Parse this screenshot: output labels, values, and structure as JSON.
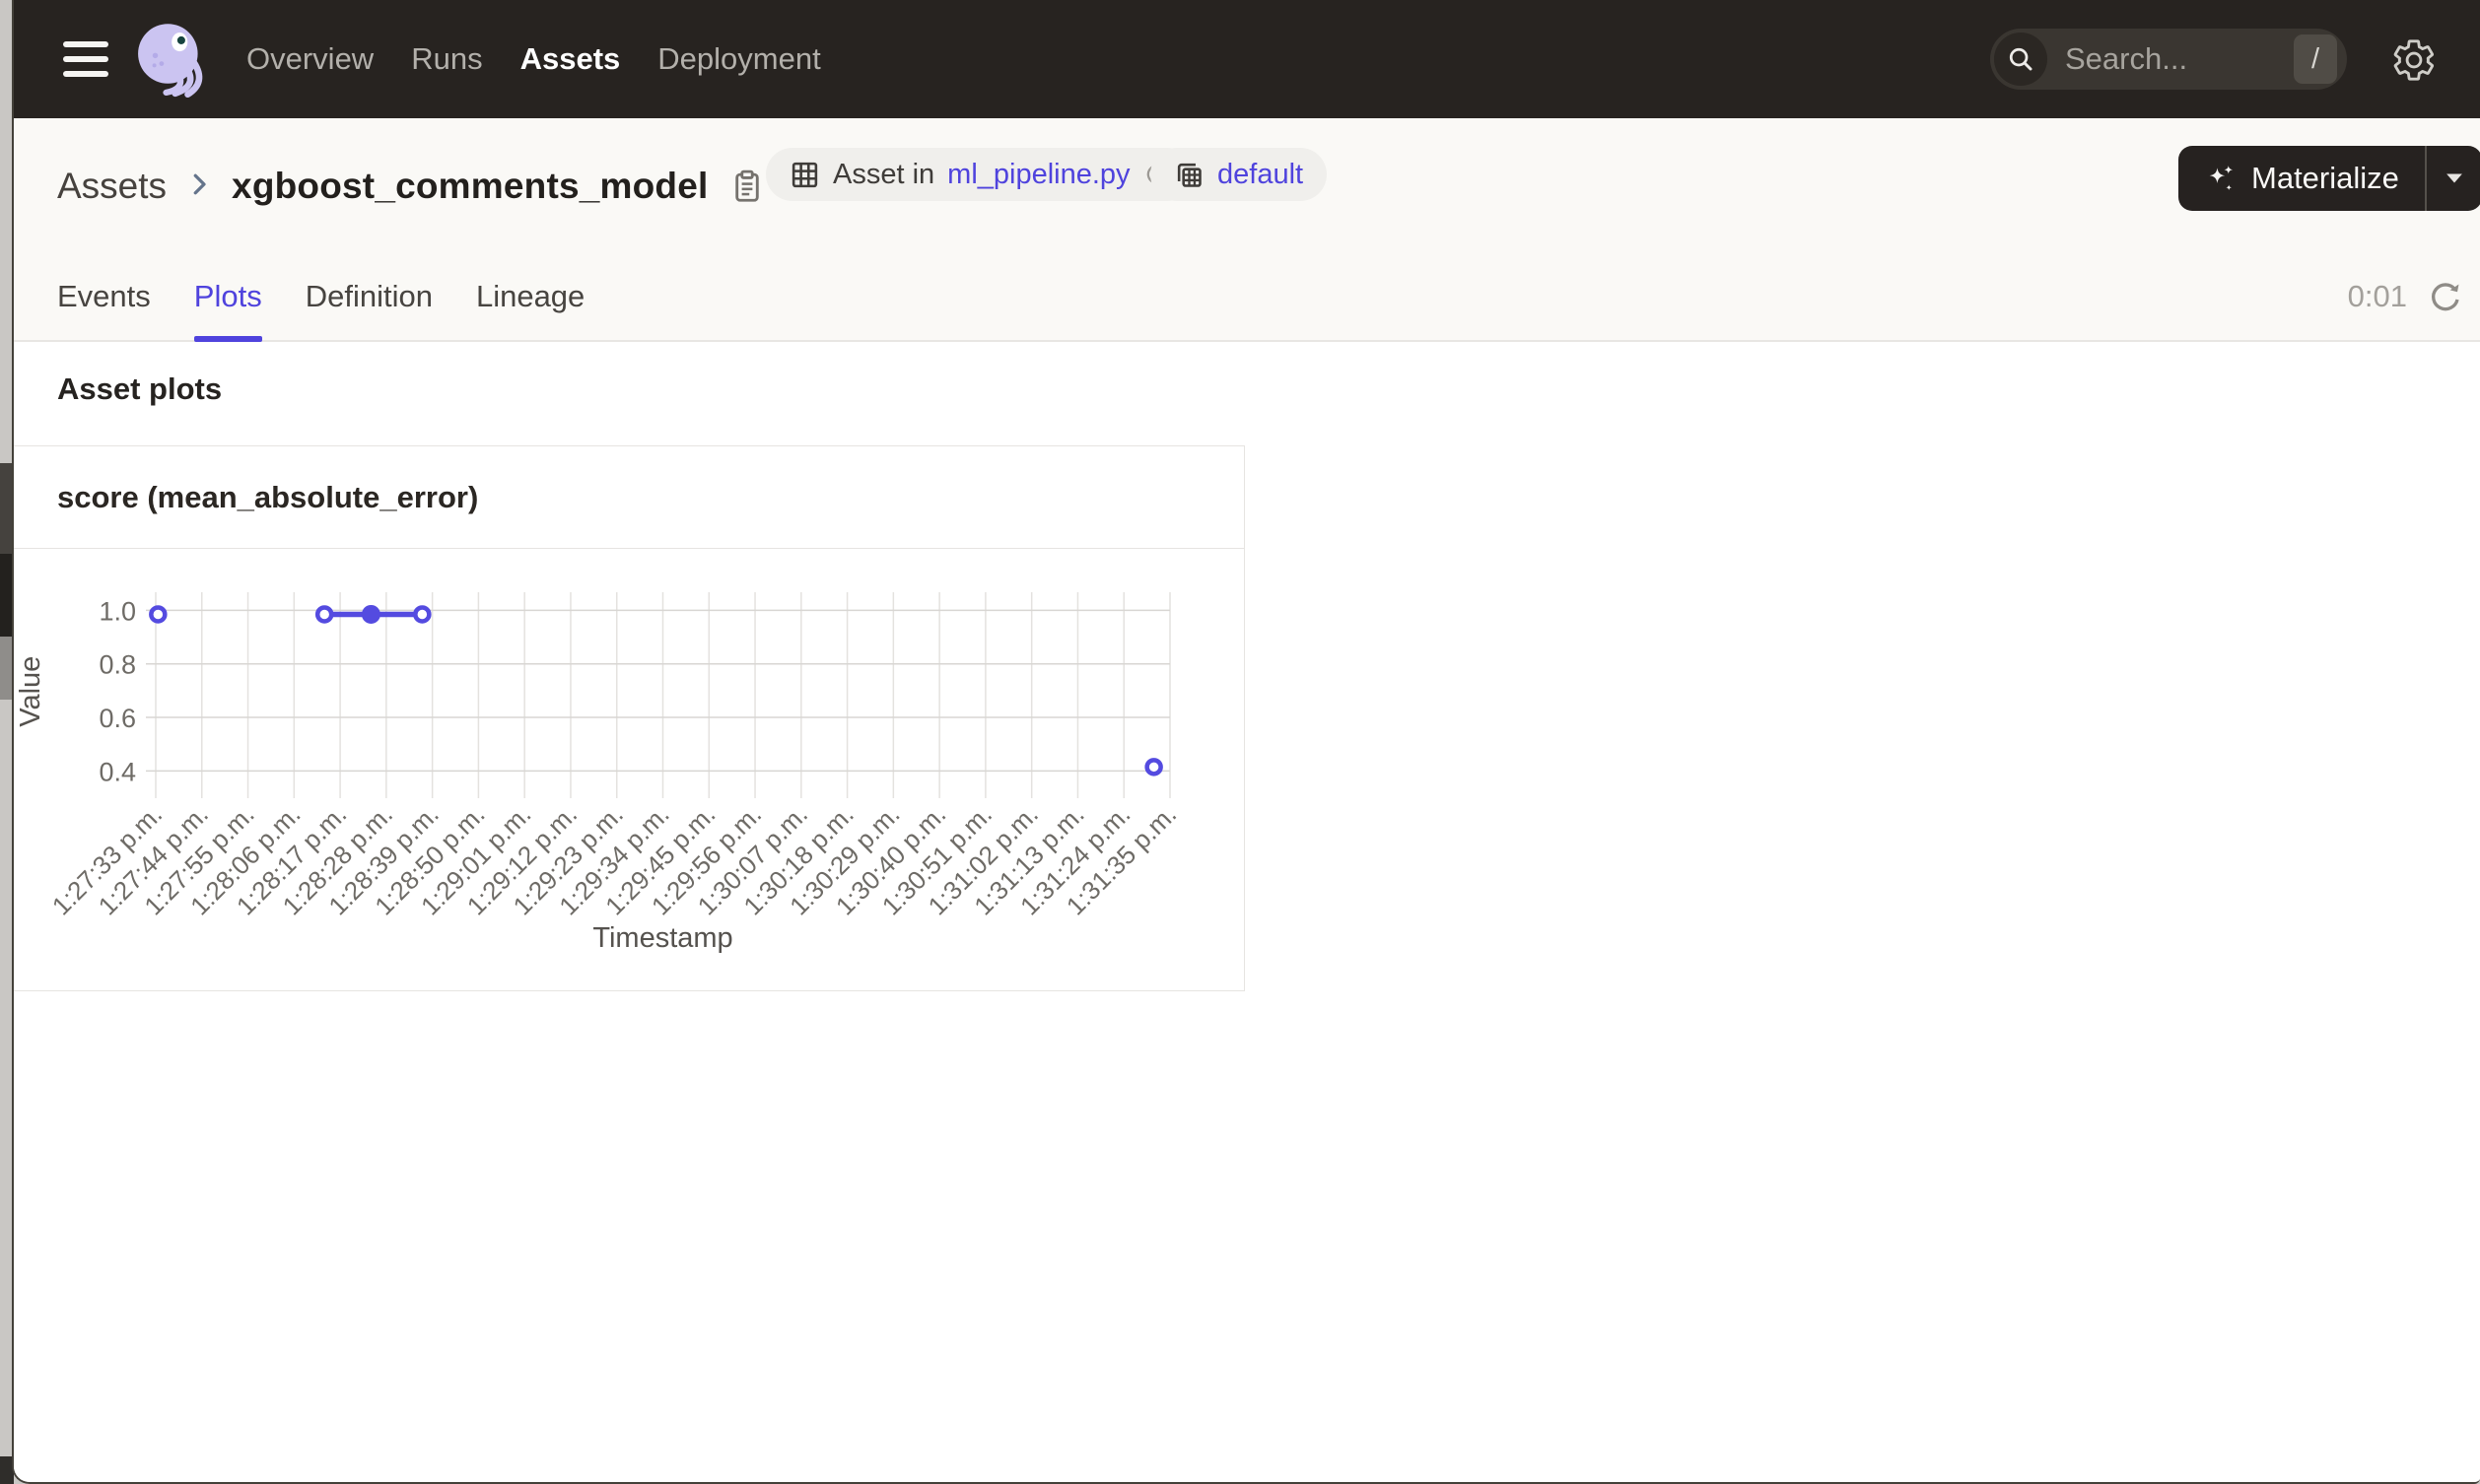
{
  "nav": {
    "items": [
      {
        "label": "Overview",
        "active": false
      },
      {
        "label": "Runs",
        "active": false
      },
      {
        "label": "Assets",
        "active": true
      },
      {
        "label": "Deployment",
        "active": false
      }
    ],
    "search_placeholder": "Search...",
    "search_shortcut": "/"
  },
  "breadcrumb": {
    "root": "Assets",
    "title": "xgboost_comments_model"
  },
  "badges": {
    "asset_in_prefix": "Asset in",
    "asset_in_file": "ml_pipeline.py",
    "group": "default"
  },
  "actions": {
    "materialize": "Materialize"
  },
  "tabs": {
    "items": [
      {
        "label": "Events",
        "active": false
      },
      {
        "label": "Plots",
        "active": true
      },
      {
        "label": "Definition",
        "active": false
      },
      {
        "label": "Lineage",
        "active": false
      }
    ],
    "timer": "0:01"
  },
  "section": {
    "heading": "Asset plots"
  },
  "chart_data": {
    "type": "line",
    "title": "score (mean_absolute_error)",
    "xlabel": "Timestamp",
    "ylabel": "Value",
    "y_ticks": [
      0.4,
      0.6,
      0.8,
      1.0
    ],
    "ylim": [
      0.35,
      1.07
    ],
    "grid": true,
    "legend": "none",
    "line_color": "#544BE0",
    "x_tick_labels": [
      "1:27:33 p.m.",
      "1:27:44 p.m.",
      "1:27:55 p.m.",
      "1:28:06 p.m.",
      "1:28:17 p.m.",
      "1:28:28 p.m.",
      "1:28:39 p.m.",
      "1:28:50 p.m.",
      "1:29:01 p.m.",
      "1:29:12 p.m.",
      "1:29:23 p.m.",
      "1:29:34 p.m.",
      "1:29:45 p.m.",
      "1:29:56 p.m.",
      "1:30:07 p.m.",
      "1:30:18 p.m.",
      "1:30:29 p.m.",
      "1:30:40 p.m.",
      "1:30:51 p.m.",
      "1:31:02 p.m.",
      "1:31:13 p.m.",
      "1:31:24 p.m.",
      "1:31:35 p.m."
    ],
    "points": [
      {
        "time": "1:27:33 p.m.",
        "tick_pos": 0.05,
        "value": 0.985,
        "marker": "open",
        "connected": false
      },
      {
        "time": "1:28:13 p.m.",
        "tick_pos": 3.66,
        "value": 0.985,
        "marker": "open",
        "connected": true
      },
      {
        "time": "1:28:24 p.m.",
        "tick_pos": 4.67,
        "value": 0.985,
        "marker": "filled",
        "connected": true
      },
      {
        "time": "1:28:36 p.m.",
        "tick_pos": 5.78,
        "value": 0.985,
        "marker": "open",
        "connected": true
      },
      {
        "time": "1:31:31 p.m.",
        "tick_pos": 21.65,
        "value": 0.415,
        "marker": "open",
        "connected": false
      }
    ]
  },
  "colors": {
    "accent": "#4F43DD",
    "chart_line": "#544BE0",
    "header_bg": "#272320"
  }
}
